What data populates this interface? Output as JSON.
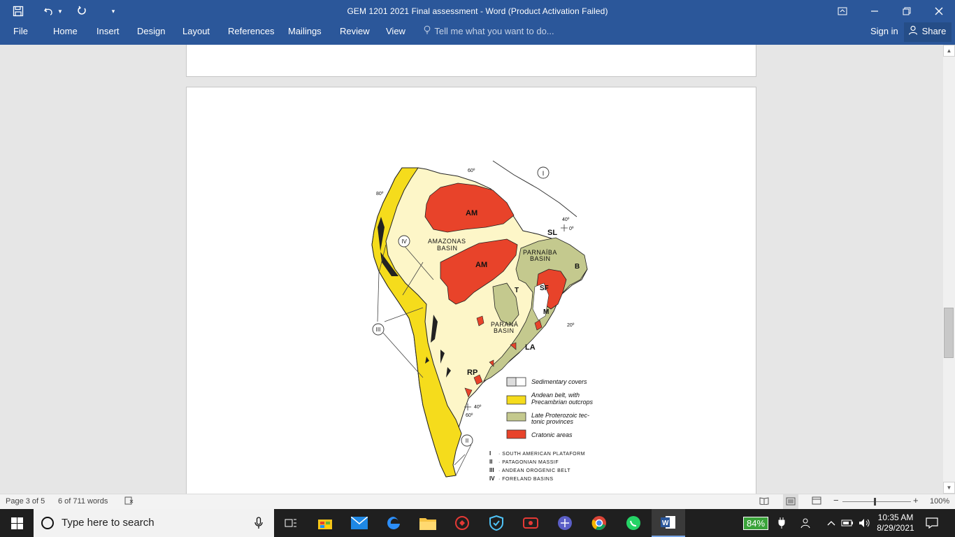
{
  "window": {
    "title": "GEM 1201 2021 Final assessment - Word (Product Activation Failed)"
  },
  "quick_access": {
    "save_icon": "save-icon",
    "undo_icon": "undo-icon",
    "redo_icon": "redo-icon",
    "customize_icon": "customize-qat-icon"
  },
  "ribbon": {
    "tabs": [
      "File",
      "Home",
      "Insert",
      "Design",
      "Layout",
      "References",
      "Mailings",
      "Review",
      "View"
    ],
    "tell_me": "Tell me what you want to do...",
    "sign_in": "Sign in",
    "share": "Share"
  },
  "figure": {
    "labels": {
      "am1": "AM",
      "am2": "AM",
      "amazonas1": "AMAZONAS",
      "amazonas2": "BASIN",
      "parnaiba1": "PARNAÍBA",
      "parnaiba2": "BASIN",
      "parana1": "PARANÁ",
      "parana2": "BASIN",
      "sl": "SL",
      "b": "B",
      "sf": "SF",
      "t": "T",
      "m": "M",
      "la": "LA",
      "rp": "RP",
      "roman1": "I",
      "roman2": "II",
      "roman3": "III",
      "roman4": "IV",
      "deg60top": "60º",
      "deg80": "80º",
      "deg40a": "40º",
      "deg0": "0º",
      "deg20": "20º",
      "deg40b": "40º",
      "deg60b": "60º"
    },
    "legend": [
      {
        "text1": "Sedimentary covers",
        "text2": "",
        "color": "#ffffff"
      },
      {
        "text1": "Andean belt, with",
        "text2": "Precambrian outcrops",
        "color": "#f5dc1c"
      },
      {
        "text1": "Late Proterozoic tec-",
        "text2": "tonic provinces",
        "color": "#c4c98e"
      },
      {
        "text1": "Cratonic areas",
        "text2": "",
        "color": "#e8432a"
      }
    ],
    "key": [
      {
        "num": "I",
        "text": "· SOUTH AMERICAN PLATAFORM"
      },
      {
        "num": "II",
        "text": "· PATAGONIAN MASSIF"
      },
      {
        "num": "III",
        "text": "· ANDEAN OROGENIC BELT"
      },
      {
        "num": "IV",
        "text": "· FORELAND BASINS"
      }
    ]
  },
  "status": {
    "page": "Page 3 of 5",
    "words": "6 of 711 words",
    "zoom": "100%"
  },
  "taskbar": {
    "search_placeholder": "Type here to search",
    "battery": "84%",
    "time": "10:35 AM",
    "date": "8/29/2021"
  }
}
